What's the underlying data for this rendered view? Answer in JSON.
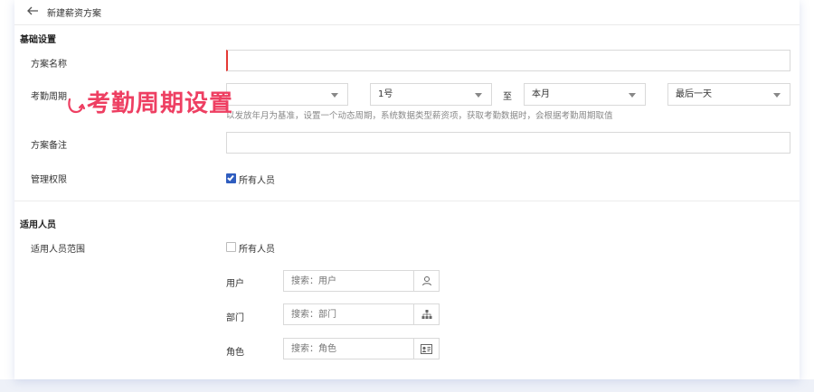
{
  "header": {
    "title": "新建薪资方案"
  },
  "basic": {
    "section_title": "基础设置",
    "name_label": "方案名称",
    "cycle_label": "考勤周期",
    "cycle_start_day": "1号",
    "cycle_to": "至",
    "cycle_end_month": "本月",
    "cycle_end_day": "最后一天",
    "hint": "以发放年月为基准，设置一个动态周期，系统数据类型薪资项，获取考勤数据时，会根据考勤周期取值",
    "remark_label": "方案备注",
    "permission_label": "管理权限",
    "permission_all": "所有人员"
  },
  "annotation": {
    "text": "考勤周期设置"
  },
  "applicable": {
    "section_title": "适用人员",
    "scope_label": "适用人员范围",
    "scope_all": "所有人员",
    "user_label": "用户",
    "user_placeholder": "搜索：用户",
    "dept_label": "部门",
    "dept_placeholder": "搜索：部门",
    "role_label": "角色",
    "role_placeholder": "搜索：角色"
  },
  "colors": {
    "accent": "#2f5dbf",
    "annotation": "#ee3f62",
    "focus": "#e53935"
  }
}
